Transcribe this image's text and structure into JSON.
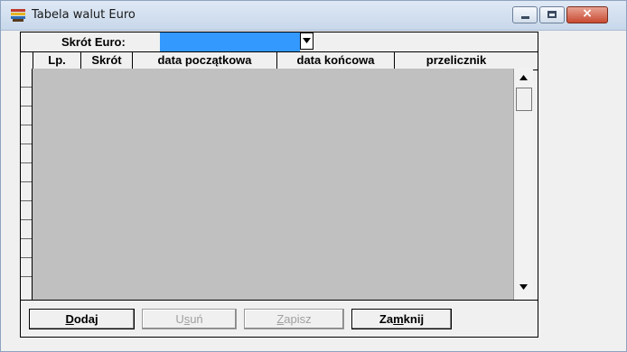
{
  "window": {
    "title": "Tabela walut Euro",
    "close_glyph": "×"
  },
  "filter": {
    "label": "Skrót Euro:",
    "value": ""
  },
  "table": {
    "columns": [
      "Lp.",
      "Skrót",
      "data początkowa",
      "data końcowa",
      "przelicznik"
    ],
    "row_count_visible": 11
  },
  "buttons": {
    "add": {
      "pre": "",
      "accel": "D",
      "post": "odaj"
    },
    "delete": {
      "pre": "U",
      "accel": "s",
      "post": "uń"
    },
    "save": {
      "pre": "",
      "accel": "Z",
      "post": "apisz"
    },
    "close": {
      "pre": "Za",
      "accel": "m",
      "post": "knij"
    }
  },
  "colors": {
    "selection": "#3399ff",
    "grid_background": "#c0c0c0"
  }
}
